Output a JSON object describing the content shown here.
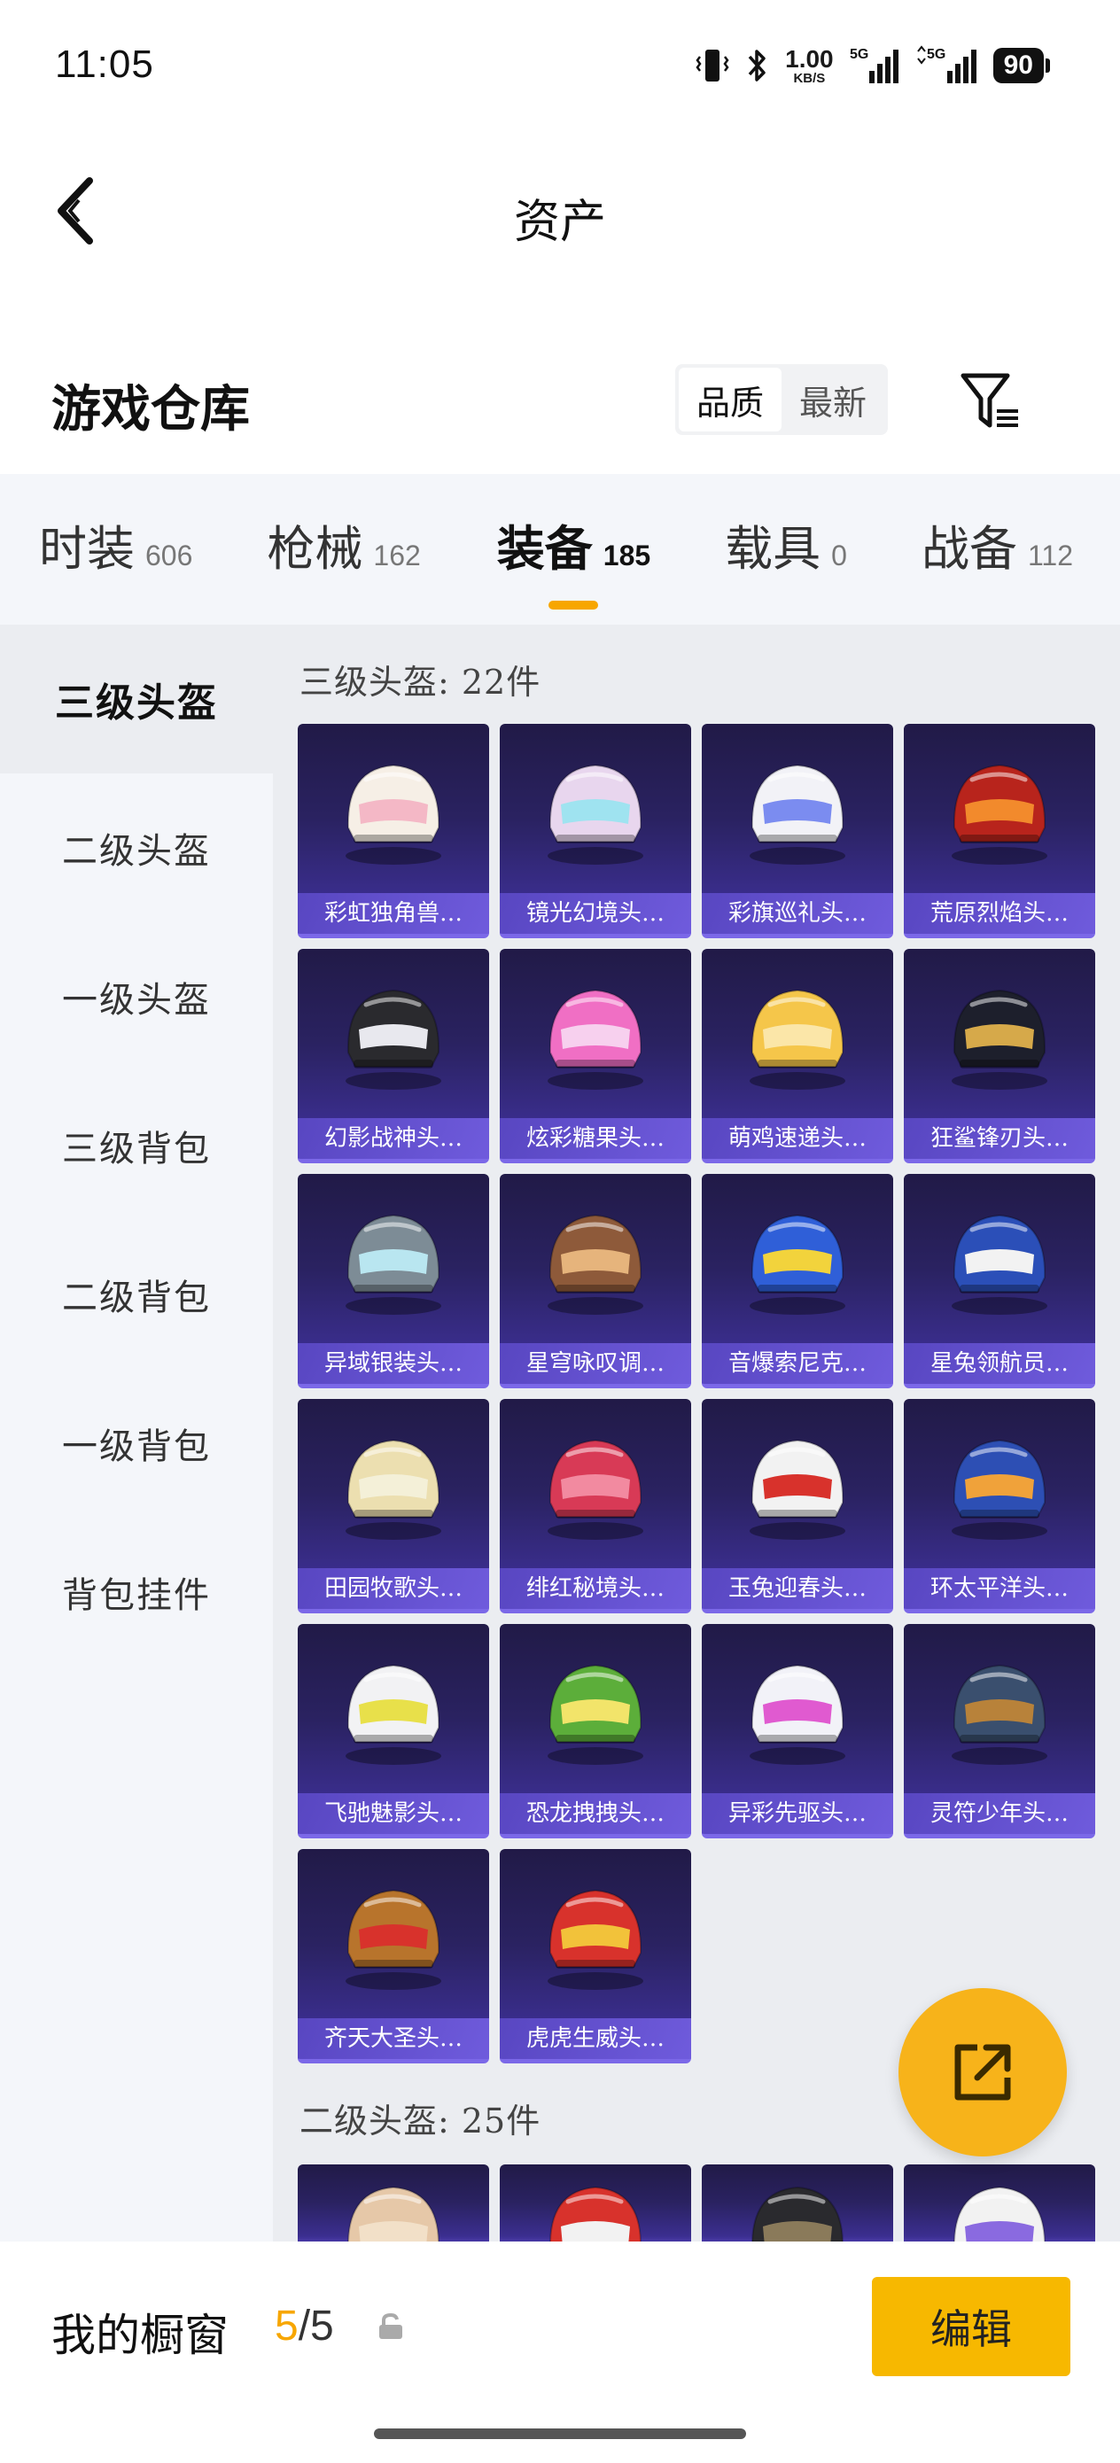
{
  "status_bar": {
    "time": "11:05",
    "net_speed_value": "1.00",
    "net_speed_unit": "KB/S",
    "signal1_label": "5G",
    "signal2_label": "5G",
    "battery": "90"
  },
  "nav": {
    "title": "资产"
  },
  "warehouse": {
    "title": "游戏仓库",
    "sort_options": [
      "品质",
      "最新"
    ],
    "active_sort": "品质"
  },
  "category_tabs": [
    {
      "name": "时装",
      "count": "606"
    },
    {
      "name": "枪械",
      "count": "162"
    },
    {
      "name": "装备",
      "count": "185",
      "active": true
    },
    {
      "name": "载具",
      "count": "0"
    },
    {
      "name": "战备",
      "count": "112"
    }
  ],
  "sidebar": {
    "items": [
      "三级头盔",
      "二级头盔",
      "一级头盔",
      "三级背包",
      "二级背包",
      "一级背包",
      "背包挂件"
    ],
    "active": "三级头盔"
  },
  "sections": [
    {
      "title": "三级头盔: 22件",
      "items": [
        {
          "name": "彩虹独角兽…",
          "icon": "unicorn-helmet-icon",
          "colors": [
            "#f6efe6",
            "#f4b8c6"
          ]
        },
        {
          "name": "镜光幻境头…",
          "icon": "mirror-helmet-icon",
          "colors": [
            "#e8d6ee",
            "#9fe3f0"
          ]
        },
        {
          "name": "彩旗巡礼头…",
          "icon": "flag-helmet-icon",
          "colors": [
            "#f2f2f7",
            "#7b8cf0"
          ]
        },
        {
          "name": "荒原烈焰头…",
          "icon": "flame-helmet-icon",
          "colors": [
            "#b8241c",
            "#f28a2c"
          ]
        },
        {
          "name": "幻影战神头…",
          "icon": "phantom-helmet-icon",
          "colors": [
            "#2a2a2e",
            "#e8e8ee"
          ]
        },
        {
          "name": "炫彩糖果头…",
          "icon": "candy-helmet-icon",
          "colors": [
            "#f06fc4",
            "#f7d0ee"
          ]
        },
        {
          "name": "萌鸡速递头…",
          "icon": "chick-helmet-icon",
          "colors": [
            "#f5c64a",
            "#fbe6a8"
          ]
        },
        {
          "name": "狂鲨锋刃头…",
          "icon": "shark-helmet-icon",
          "colors": [
            "#1d1f2c",
            "#d6a94a"
          ]
        },
        {
          "name": "异域银装头…",
          "icon": "silver-helmet-icon",
          "colors": [
            "#7d8c96",
            "#b9e6f0"
          ]
        },
        {
          "name": "星穹咏叹调…",
          "icon": "aria-helmet-icon",
          "colors": [
            "#8e5a3a",
            "#e6b47c"
          ]
        },
        {
          "name": "音爆索尼克…",
          "icon": "sonic-helmet-icon",
          "colors": [
            "#2f5fd8",
            "#f2d33c"
          ]
        },
        {
          "name": "星兔领航员…",
          "icon": "rabbit-helmet-icon",
          "colors": [
            "#2b4fb8",
            "#f2f2f2"
          ]
        },
        {
          "name": "田园牧歌头…",
          "icon": "pastoral-helmet-icon",
          "colors": [
            "#ecdfb0",
            "#f4f0d8"
          ]
        },
        {
          "name": "绯红秘境头…",
          "icon": "crimson-helmet-icon",
          "colors": [
            "#d83a56",
            "#f28aa0"
          ]
        },
        {
          "name": "玉兔迎春头…",
          "icon": "jade-rabbit-helmet-icon",
          "colors": [
            "#f2f2f2",
            "#d8322c"
          ]
        },
        {
          "name": "环太平洋头…",
          "icon": "pacific-helmet-icon",
          "colors": [
            "#2d4fb4",
            "#f0a23a"
          ]
        },
        {
          "name": "飞驰魅影头…",
          "icon": "racer-helmet-icon",
          "colors": [
            "#f2f2f4",
            "#e8e04a"
          ]
        },
        {
          "name": "恐龙拽拽头…",
          "icon": "dino-helmet-icon",
          "colors": [
            "#5cae3a",
            "#f2e46a"
          ]
        },
        {
          "name": "异彩先驱头…",
          "icon": "pioneer-helmet-icon",
          "colors": [
            "#f2f2f8",
            "#e05ad0"
          ]
        },
        {
          "name": "灵符少年头…",
          "icon": "talisman-helmet-icon",
          "colors": [
            "#3a4f6e",
            "#b8823a"
          ]
        },
        {
          "name": "齐天大圣头…",
          "icon": "monkey-king-helmet-icon",
          "colors": [
            "#b8742c",
            "#d8322c"
          ]
        },
        {
          "name": "虎虎生威头…",
          "icon": "tiger-helmet-icon",
          "colors": [
            "#d8322c",
            "#f2c23a"
          ]
        }
      ]
    },
    {
      "title": "二级头盔: 25件",
      "items": [
        {
          "name": "",
          "icon": "helmet-icon",
          "colors": [
            "#e6c8a8",
            "#f2e0c8"
          ]
        },
        {
          "name": "",
          "icon": "helmet-icon",
          "colors": [
            "#d8322c",
            "#f2f2f2"
          ]
        },
        {
          "name": "",
          "icon": "helmet-icon",
          "colors": [
            "#2a2a2e",
            "#8a7a5a"
          ]
        },
        {
          "name": "",
          "icon": "helmet-icon",
          "colors": [
            "#f2f2f2",
            "#8a6ae0"
          ]
        }
      ]
    }
  ],
  "bottom_bar": {
    "label": "我的橱窗",
    "current": "5",
    "separator": "/",
    "max": "5",
    "edit_label": "编辑"
  },
  "colors": {
    "accent": "#f7a600",
    "card_bg": "#2a2261",
    "card_label_bg": "#6a56d6"
  }
}
